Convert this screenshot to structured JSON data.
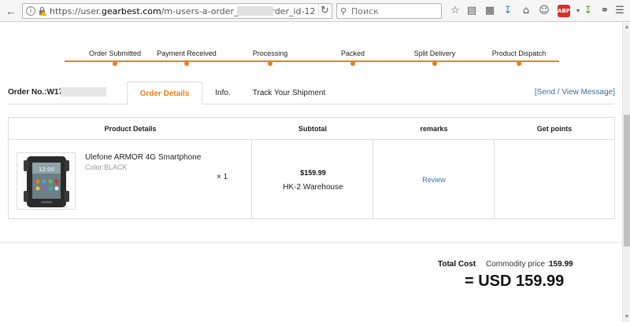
{
  "browser": {
    "url_prefix": "https://user.",
    "url_host": "gearbest.com",
    "url_path": "/m-users-a-order_detail-order_id-12",
    "search_placeholder": "Поиск",
    "addon_label": "ABP"
  },
  "progress": {
    "steps": [
      {
        "label": "Order Submitted"
      },
      {
        "label": "Payment Received"
      },
      {
        "label": "Processing"
      },
      {
        "label": "Packed"
      },
      {
        "label": "Split Delivery"
      },
      {
        "label": "Product Dispatch"
      }
    ],
    "accent_color": "#e8811a"
  },
  "order": {
    "number_label": "Order No.:W170",
    "tabs": [
      "Order Details",
      "Info.",
      "Track Your Shipment"
    ],
    "active_tab": "Order Details",
    "send_message": "[Send / View Message]"
  },
  "table": {
    "headers": [
      "Product Details",
      "Subtotal",
      "remarks",
      "Get points"
    ],
    "rows": [
      {
        "name": "Ulefone ARMOR 4G Smartphone",
        "color": "Color:BLACK",
        "qty": "× 1",
        "price": "$159.99",
        "warehouse": "HK-2 Warehouse",
        "remarks": "Review"
      }
    ]
  },
  "totals": {
    "total_cost_label": "Total Cost",
    "commodity_label": "Commodity price :",
    "commodity_value": "159.99",
    "grand_total": "= USD 159.99"
  }
}
